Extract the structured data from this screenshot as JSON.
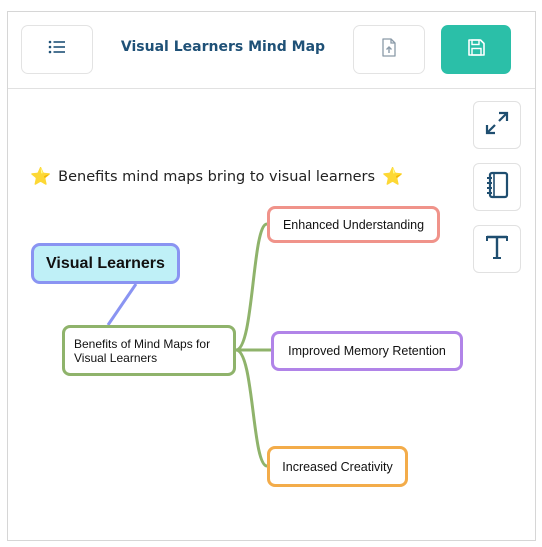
{
  "header": {
    "title": "Visual Learners Mind Map",
    "menu_icon": "list-icon",
    "upload_icon": "file-upload-icon",
    "save_icon": "floppy-disk-icon",
    "save_color": "#2bbfa8",
    "title_color": "#1f5177"
  },
  "tools": {
    "expand_icon": "expand-arrows-icon",
    "notebook_icon": "notebook-icon",
    "text_icon": "text-tool-icon"
  },
  "canvas": {
    "heading_prefix": "⭐",
    "heading_text": "Benefits mind maps bring to visual learners",
    "heading_suffix": "⭐",
    "root_label": "Visual Learners",
    "central_label_line1": "Benefits of Mind Maps for",
    "central_label_line2": "Visual Learners",
    "branches": [
      {
        "label": "Enhanced Understanding",
        "color": "#f0938a"
      },
      {
        "label": "Improved Memory Retention",
        "color": "#b184e8"
      },
      {
        "label": "Increased Creativity",
        "color": "#f3ac4a"
      }
    ],
    "root_fill": "#bff0f7",
    "root_border": "#8a94f2",
    "central_border": "#8fb36b"
  }
}
